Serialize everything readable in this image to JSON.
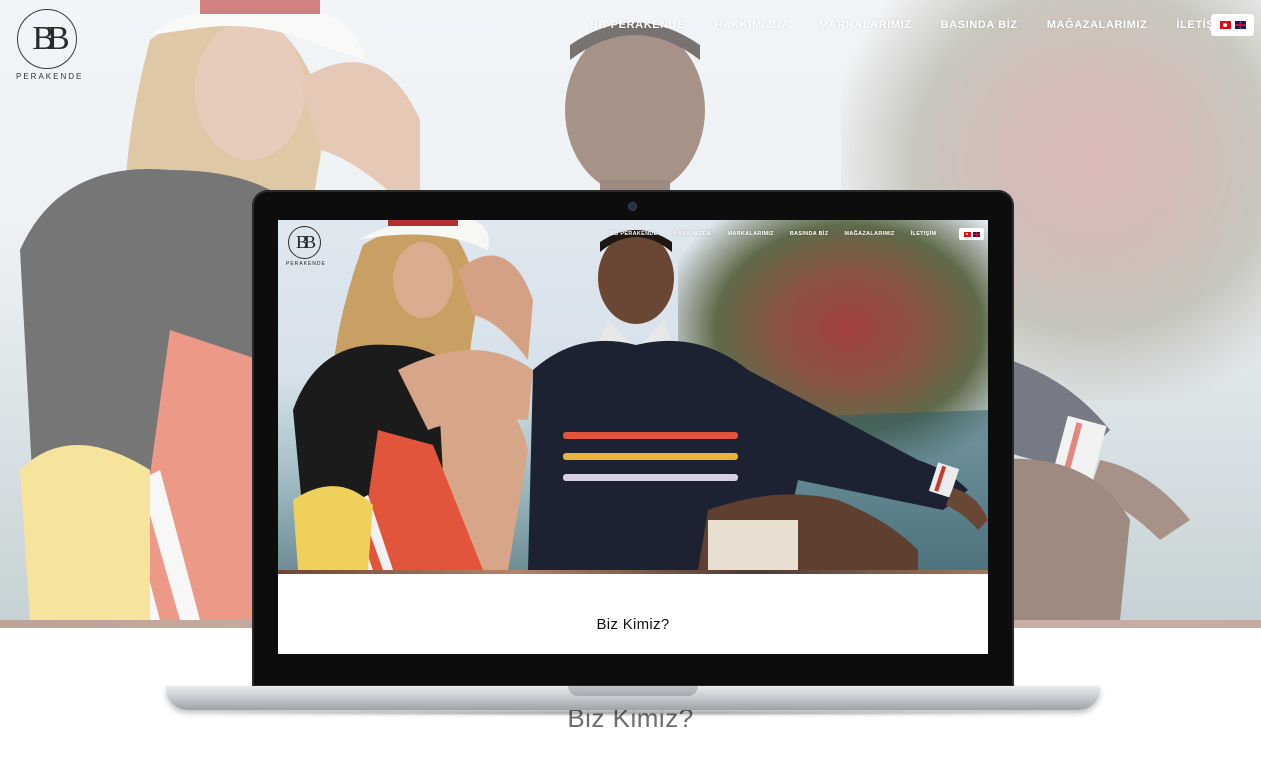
{
  "site": {
    "logo_text": "PERAKENDE",
    "logo_monogram": "BB",
    "nav": [
      {
        "label": "BB PERAKENDE"
      },
      {
        "label": "HAKKIMIZDA"
      },
      {
        "label": "MARKALARIMIZ"
      },
      {
        "label": "BASINDA BİZ"
      },
      {
        "label": "MAĞAZALARIMIZ"
      },
      {
        "label": "İLETİŞİM"
      }
    ],
    "languages": [
      "tr-flag-icon",
      "gb-flag-icon"
    ],
    "section_title": "Biz Kimiz?"
  },
  "colors": {
    "accent_red": "#e2553a",
    "sweater_navy": "#1d2233",
    "text_dark": "#111111"
  }
}
